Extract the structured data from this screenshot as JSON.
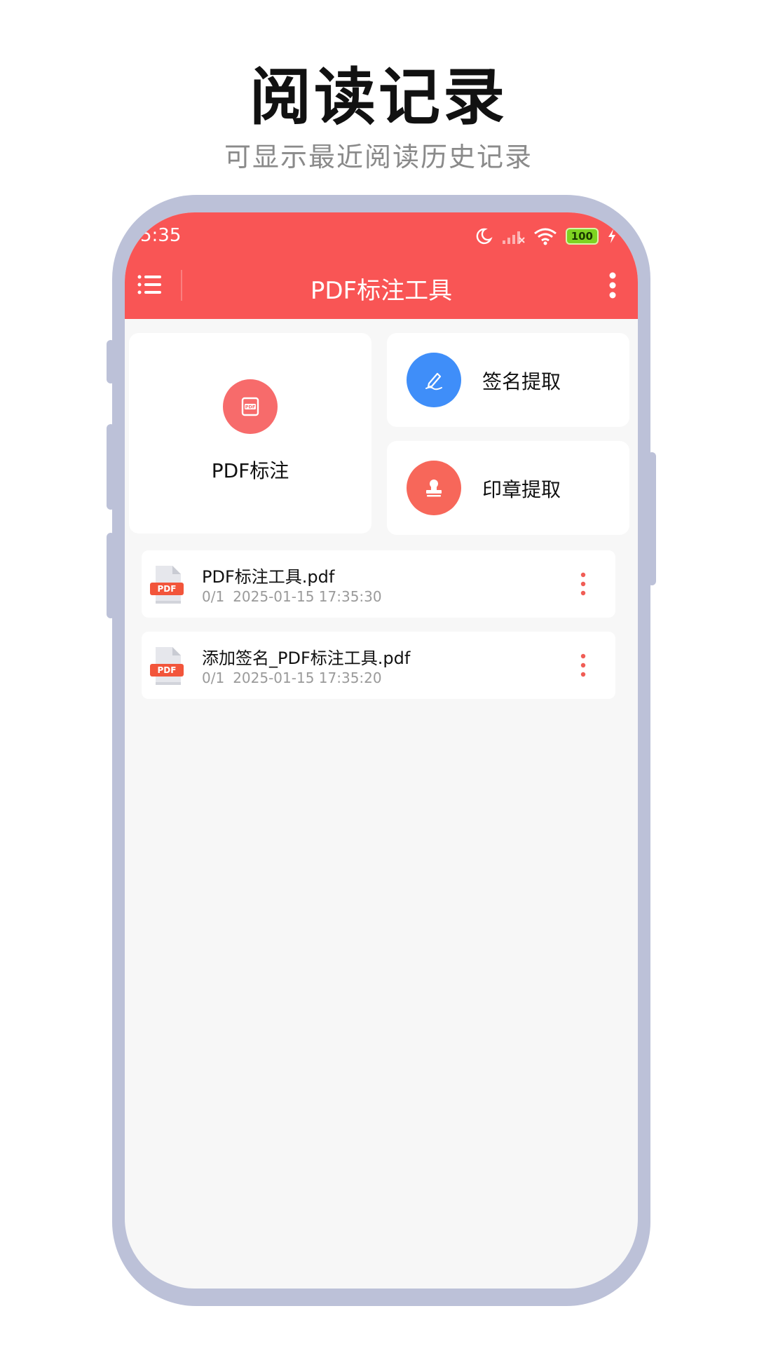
{
  "promo": {
    "title": "阅读记录",
    "subtitle": "可显示最近阅读历史记录"
  },
  "status_bar": {
    "time": "5:35",
    "battery": "100"
  },
  "app_bar": {
    "title": "PDF标注工具"
  },
  "features": {
    "pdf_annotate": {
      "label": "PDF标注",
      "icon": "pdf-icon",
      "color": "#f76b6b"
    },
    "signature_extract": {
      "label": "签名提取",
      "icon": "pen-icon",
      "color": "#3f8ef9"
    },
    "seal_extract": {
      "label": "印章提取",
      "icon": "stamp-icon",
      "color": "#f7675a"
    }
  },
  "recent_files": [
    {
      "name": "PDF标注工具.pdf",
      "pages": "0/1",
      "time": "2025-01-15 17:35:30"
    },
    {
      "name": "添加签名_PDF标注工具.pdf",
      "pages": "0/1",
      "time": "2025-01-15 17:35:20"
    }
  ],
  "colors": {
    "accent": "#f95555",
    "frame": "#bcc1d8",
    "background": "#f7f7f7"
  }
}
